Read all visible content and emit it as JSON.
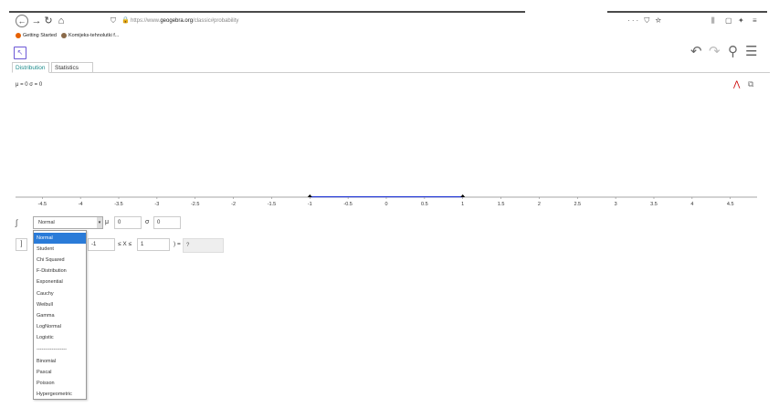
{
  "browser": {
    "url_prefix": "https://www.",
    "url_domain": "geogebra.org",
    "url_path": "/classic#probability",
    "url_actions": "··· ⛉ ☆",
    "toolbar_icons": [
      "library-icon",
      "reader-icon",
      "extension-icon",
      "menu-icon"
    ]
  },
  "bookmarks": [
    {
      "label": "Getting Started",
      "color": "#e66000"
    },
    {
      "label": "Komijeks-tehnolutki f...",
      "color": "#8a6a4a"
    }
  ],
  "app": {
    "tabs": [
      {
        "label": "Distribution",
        "active": true
      },
      {
        "label": "Statistics",
        "active": false
      }
    ],
    "graph_header": "μ = 0 σ = 0",
    "axis_ticks": [
      "-4.5",
      "-4",
      "-3.5",
      "-3",
      "-2.5",
      "-2",
      "-1.5",
      "-1",
      "-0.5",
      "0",
      "0.5",
      "1",
      "1.5",
      "2",
      "2.5",
      "3",
      "3.5",
      "4",
      "4.5"
    ],
    "interval_low": -1,
    "interval_high": 1,
    "axis_min": -4.85,
    "axis_max": 4.85,
    "accent_color": "#cc0000",
    "interval_color": "#2a3fd8"
  },
  "distribution": {
    "selected": "Normal",
    "mu_label": "μ",
    "mu_value": "0",
    "sigma_label": "σ",
    "sigma_value": "0",
    "options": [
      "Normal",
      "Student",
      "Chi Squared",
      "F-Distribution",
      "Exponential",
      "Cauchy",
      "Weibull",
      "Gamma",
      "LogNormal",
      "Logistic",
      "------------------",
      "Binomial",
      "Pascal",
      "Poisson",
      "Hypergeometric"
    ]
  },
  "probability": {
    "bracket": "]",
    "low_value": "-1",
    "relation": "≤ X ≤",
    "high_value": "1",
    "equals": ") =",
    "result": "?"
  }
}
